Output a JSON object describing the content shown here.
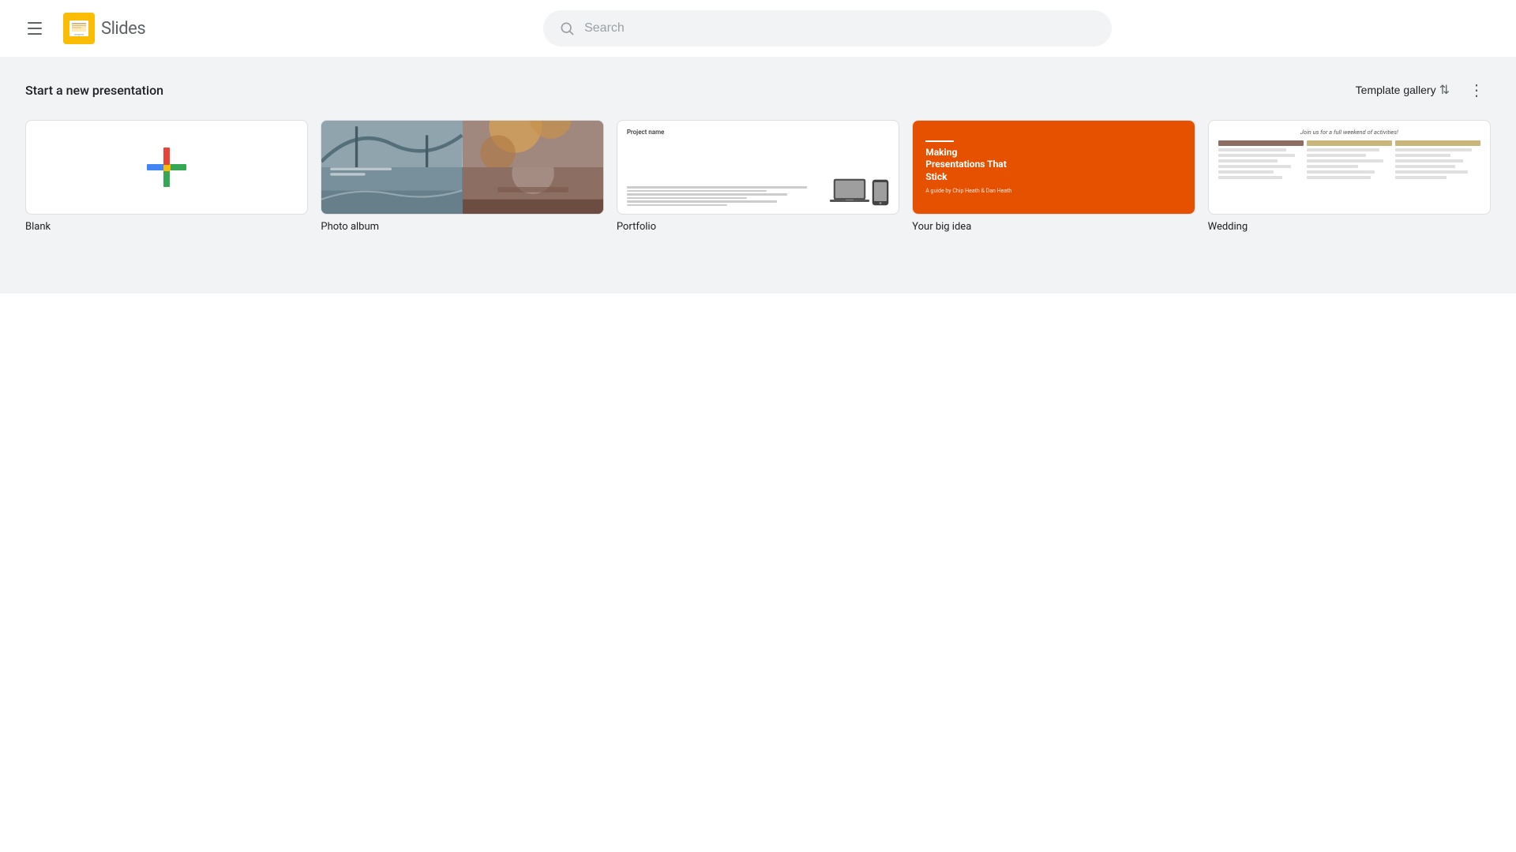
{
  "header": {
    "app_name": "Slides",
    "search_placeholder": "Search"
  },
  "template_section": {
    "title": "Start a new presentation",
    "template_gallery_label": "Template gallery",
    "templates": [
      {
        "id": "blank",
        "name": "Blank"
      },
      {
        "id": "photo-album",
        "name": "Photo album"
      },
      {
        "id": "portfolio",
        "name": "Portfolio"
      },
      {
        "id": "your-big-idea",
        "name": "Your big idea"
      },
      {
        "id": "wedding",
        "name": "Wedding"
      }
    ]
  }
}
